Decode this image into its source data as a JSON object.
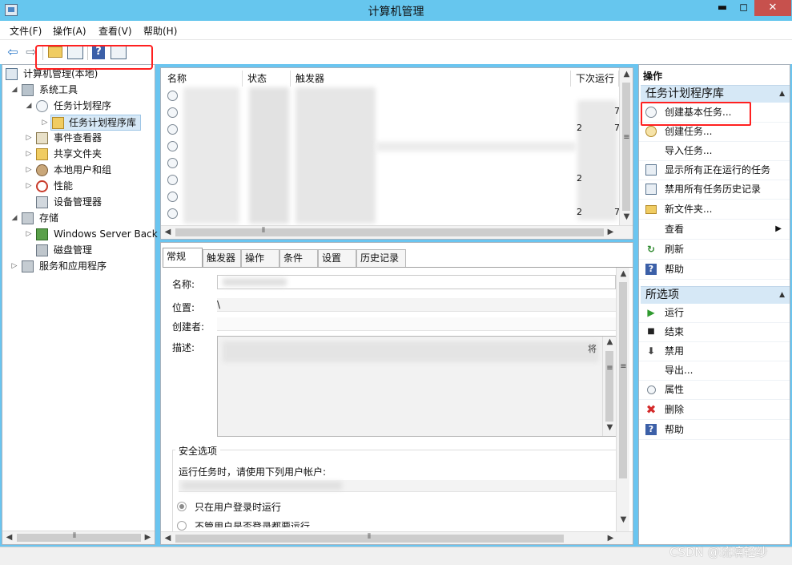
{
  "window": {
    "title": "计算机管理",
    "min": "▬",
    "max": "◻",
    "close": "✕"
  },
  "menu": [
    "文件(F)",
    "操作(A)",
    "查看(V)",
    "帮助(H)"
  ],
  "toolbar": {
    "back": "⇦",
    "forward": "⇨",
    "help": "?"
  },
  "tree": {
    "root": "计算机管理(本地)",
    "system_tools": "系统工具",
    "task_scheduler": "任务计划程序",
    "task_library": "任务计划程序库",
    "event_viewer": "事件查看器",
    "shared_folders": "共享文件夹",
    "local_users": "本地用户和组",
    "performance": "性能",
    "device_manager": "设备管理器",
    "storage": "存储",
    "windows_backup": "Windows Server Back",
    "disk_management": "磁盘管理",
    "services_apps": "服务和应用程序"
  },
  "task_list": {
    "columns": [
      "名称",
      "状态",
      "触发器",
      "下次运行时"
    ],
    "visible_fragments": [
      "7",
      "2",
      "7",
      "2",
      "2",
      "7"
    ]
  },
  "detail": {
    "tabs": [
      "常规",
      "触发器",
      "操作",
      "条件",
      "设置",
      "历史记录"
    ],
    "name_label": "名称:",
    "location_label": "位置:",
    "location_value": "\\",
    "author_label": "创建者:",
    "description_label": "描述:",
    "description_fragment": "将",
    "security_group": "安全选项",
    "run_as_label": "运行任务时，请使用下列用户帐户:",
    "radio_logged_on": "只在用户登录时运行",
    "radio_whether": "不管用户是否登录都要运行"
  },
  "actions": {
    "title": "操作",
    "section_library": "任务计划程序库",
    "library_items": [
      {
        "label": "创建基本任务...",
        "icon": "clock-icon"
      },
      {
        "label": "创建任务...",
        "icon": "clock-icon"
      },
      {
        "label": "导入任务...",
        "icon": ""
      },
      {
        "label": "显示所有正在运行的任务",
        "icon": "list-icon"
      },
      {
        "label": "禁用所有任务历史记录",
        "icon": "list-icon"
      },
      {
        "label": "新文件夹...",
        "icon": "folder-icon"
      },
      {
        "label": "查看",
        "icon": ""
      },
      {
        "label": "刷新",
        "icon": "refresh-icon"
      },
      {
        "label": "帮助",
        "icon": "help-icon"
      }
    ],
    "section_selected": "所选项",
    "selected_items": [
      {
        "label": "运行",
        "icon": "run-icon"
      },
      {
        "label": "结束",
        "icon": "stop-icon"
      },
      {
        "label": "禁用",
        "icon": "disable-icon"
      },
      {
        "label": "导出...",
        "icon": ""
      },
      {
        "label": "属性",
        "icon": "clock-icon"
      },
      {
        "label": "删除",
        "icon": "delete-icon"
      },
      {
        "label": "帮助",
        "icon": "help-icon"
      }
    ]
  },
  "watermark": "CSDN @琉璃轻纱",
  "colors": {
    "titlebar": "#66c6ee",
    "highlight": "#ff2020",
    "section_bg": "#d6e8f6"
  }
}
